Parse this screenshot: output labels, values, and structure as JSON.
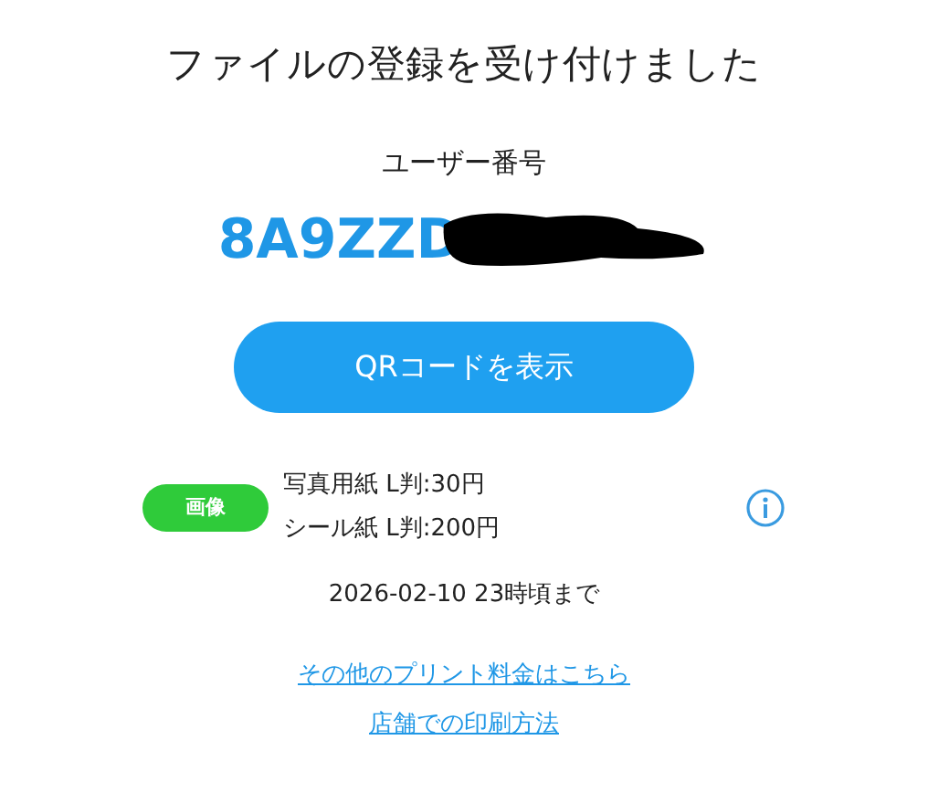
{
  "title": "ファイルの登録を受け付けました",
  "user_number_label": "ユーザー番号",
  "user_number": "8A9ZZD",
  "qr_button": "QRコードを表示",
  "pricing": {
    "badge": "画像",
    "lines": [
      "写真用紙 L判:30円",
      "シール紙 L判:200円"
    ]
  },
  "deadline": "2026-02-10 23時頃まで",
  "links": [
    "その他のプリント料金はこちら",
    "店舗での印刷方法"
  ]
}
